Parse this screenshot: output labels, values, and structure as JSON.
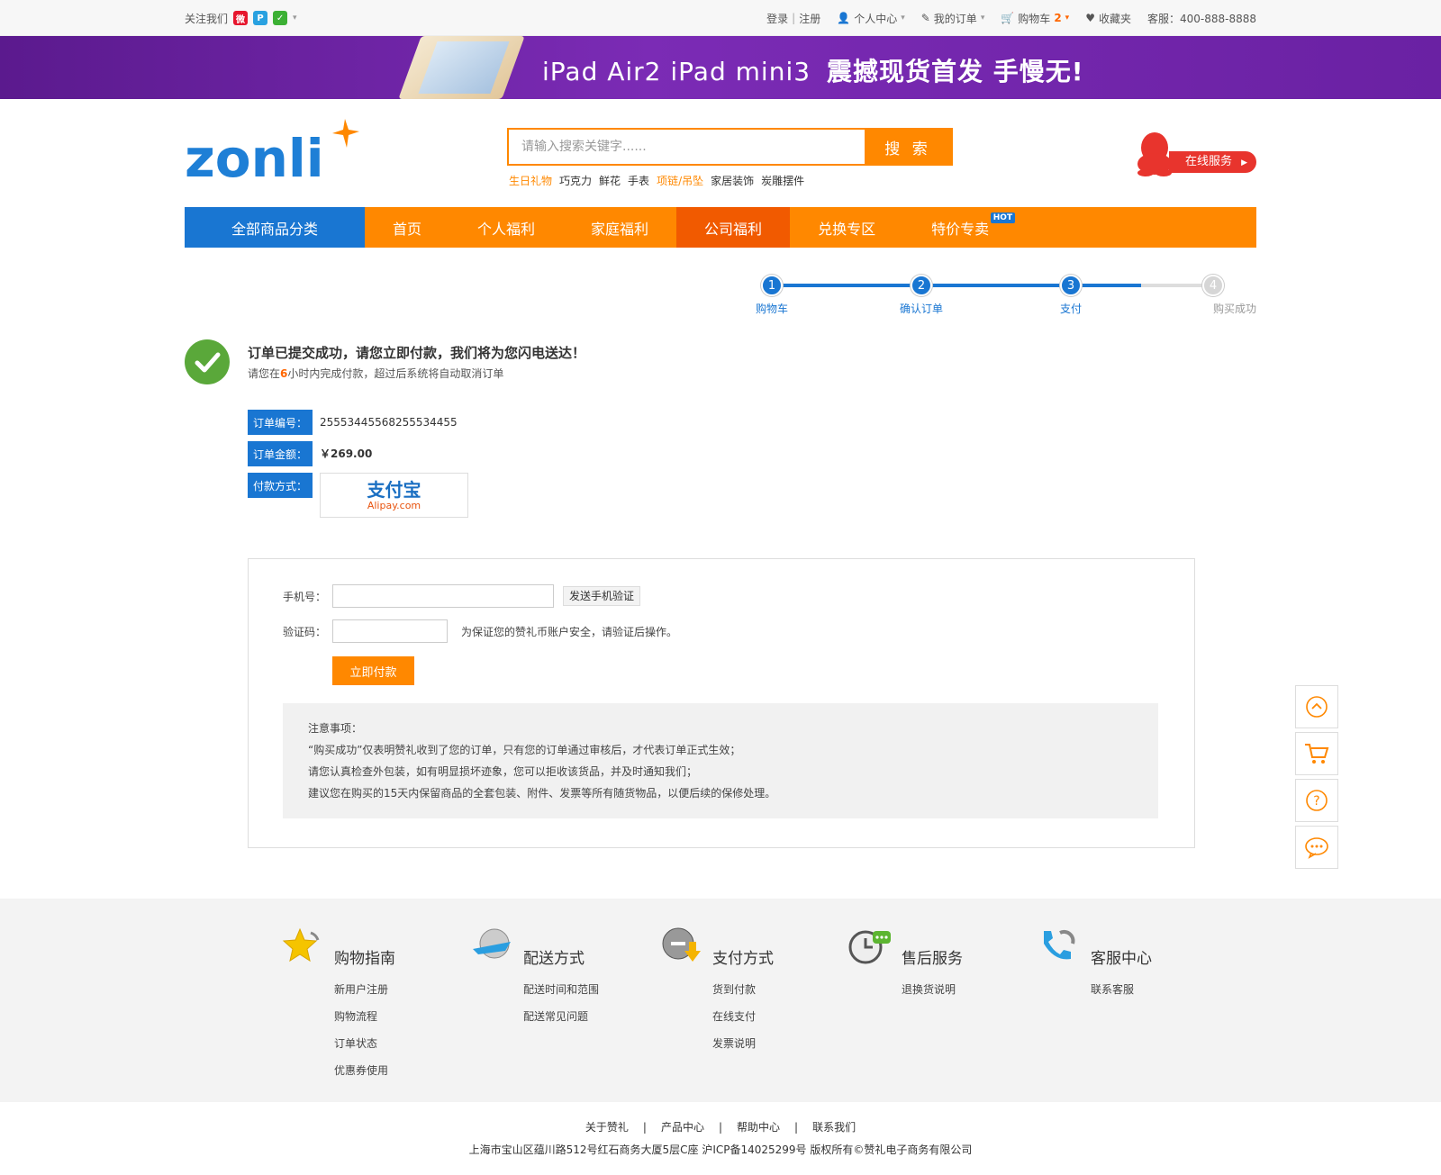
{
  "topbar": {
    "follow_label": "关注我们",
    "login": "登录",
    "sep": "|",
    "register": "注册",
    "personal": "个人中心",
    "orders": "我的订单",
    "cart": "购物车",
    "cart_count": "2",
    "favorites": "收藏夹",
    "hotline": "客服：400-888-8888"
  },
  "banner": {
    "text_a": "iPad Air2  iPad mini3",
    "text_b": "震撼现货首发 手慢无!"
  },
  "header": {
    "logo": "zonli",
    "search_placeholder": "请输入搜索关键字......",
    "search_button": "搜 索",
    "hotwords": [
      "生日礼物",
      "巧克力",
      "鲜花",
      "手表",
      "项链/吊坠",
      "家居装饰",
      "炭雕摆件"
    ],
    "service_label": "在线服务"
  },
  "nav": {
    "all_categories": "全部商品分类",
    "items": [
      "首页",
      "个人福利",
      "家庭福利",
      "公司福利",
      "兑换专区",
      "特价专卖"
    ],
    "hot_badge": "HOT"
  },
  "steps": [
    {
      "num": "1",
      "label": "购物车"
    },
    {
      "num": "2",
      "label": "确认订单"
    },
    {
      "num": "3",
      "label": "支付"
    },
    {
      "num": "4",
      "label": "购买成功"
    }
  ],
  "success": {
    "title": "订单已提交成功，请您立即付款，我们将为您闪电送达！",
    "sub_a": "请您在",
    "sub_hours": "6",
    "sub_b": "小时内完成付款，超过后系统将自动取消订单"
  },
  "order": {
    "no_label": "订单编号：",
    "no_value": "25553445568255534455",
    "amount_label": "订单金额：",
    "amount_value": "￥269.00",
    "pay_label": "付款方式：",
    "alipay_cn": "支付宝",
    "alipay_en": "Alipay.com"
  },
  "verify": {
    "phone_label": "手机号：",
    "send_button": "发送手机验证",
    "code_label": "验证码：",
    "code_hint": "为保证您的赞礼币账户安全，请验证后操作。",
    "pay_button": "立即付款"
  },
  "notes": {
    "title": "注意事项：",
    "lines": [
      "“购买成功”仅表明赞礼收到了您的订单，只有您的订单通过审核后，才代表订单正式生效；",
      "请您认真检查外包装，如有明显损坏迹象，您可以拒收该货品，并及时通知我们；",
      "建议您在购买的15天内保留商品的全套包装、附件、发票等所有随货物品，以便后续的保修处理。"
    ]
  },
  "footer": {
    "cols": [
      {
        "title": "购物指南",
        "links": [
          "新用户注册",
          "购物流程",
          "订单状态",
          "优惠券使用"
        ]
      },
      {
        "title": "配送方式",
        "links": [
          "配送时间和范围",
          "配送常见问题"
        ]
      },
      {
        "title": "支付方式",
        "links": [
          "货到付款",
          "在线支付",
          "发票说明"
        ]
      },
      {
        "title": "售后服务",
        "links": [
          "退换货说明"
        ]
      },
      {
        "title": "客服中心",
        "links": [
          "联系客服"
        ]
      }
    ],
    "bottom_links": [
      "关于赞礼",
      "产品中心",
      "帮助中心",
      "联系我们"
    ],
    "bottom_sep": "|",
    "copyright": "上海市宝山区蕴川路512号红石商务大厦5层C座 沪ICP备14025299号 版权所有©赞礼电子商务有限公司"
  },
  "colors": {
    "brand_orange": "#ff8800",
    "brand_blue": "#1976d2",
    "success_green": "#5aa83a",
    "banner_purple": "#6a21a3"
  }
}
